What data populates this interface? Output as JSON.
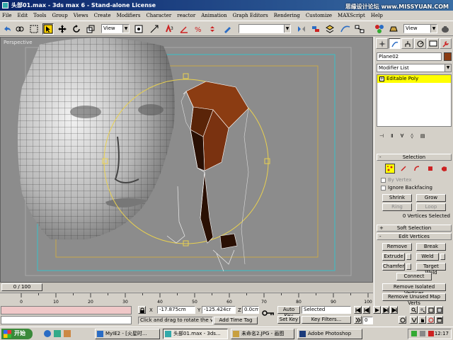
{
  "window": {
    "title": "头部01.max - 3ds max 6 - Stand-alone License",
    "watermark": "思缘设计论坛 www.MISSYUAN.COM"
  },
  "menu": [
    "File",
    "Edit",
    "Tools",
    "Group",
    "Views",
    "Create",
    "Modifiers",
    "Character",
    "reactor",
    "Animation",
    "Graph Editors",
    "Rendering",
    "Customize",
    "MAXScript",
    "Help"
  ],
  "toolbar": {
    "filter_value": "All",
    "refcoord_value": "View",
    "named_sel_value": "",
    "view_right": "View"
  },
  "viewport": {
    "label": "Perspective"
  },
  "command_panel": {
    "object_name": "Plane02",
    "modifier_list": "Modifier List",
    "stack_item": "Editable Poly",
    "selection": {
      "title": "Selection",
      "by_vertex": "By Vertex",
      "ignore_backfacing": "Ignore Backfacing",
      "shrink": "Shrink",
      "grow": "Grow",
      "ring": "Ring",
      "loop": "Loop",
      "status": "0 Vertices Selected"
    },
    "soft_selection": "Soft Selection",
    "edit_vertices": {
      "title": "Edit Vertices",
      "remove": "Remove",
      "break": "Break",
      "extrude": "Extrude",
      "weld": "Weld",
      "chamfer": "Chamfer",
      "target_weld": "Target Weld",
      "connect": "Connect",
      "remove_isolated": "Remove Isolated Vertices",
      "remove_unused": "Remove Unused Map Verts"
    }
  },
  "timeline": {
    "slider_label": "0 / 100",
    "ticks": [
      "0",
      "10",
      "20",
      "30",
      "40",
      "50",
      "60",
      "70",
      "80",
      "90",
      "100"
    ]
  },
  "status": {
    "prompt": "Click and drag to rotate the view.",
    "add_time_tag": "Add Time Tag",
    "x_label": "X",
    "x_value": "-17.875cm",
    "y_label": "Y",
    "y_value": "-125.424cr",
    "z_label": "Z",
    "z_value": "0.0cm",
    "auto_key": "Auto Key",
    "set_key": "Set Key",
    "selected": "Selected",
    "key_filters": "Key Filters...",
    "frame": "0"
  },
  "taskbar": {
    "start": "开始",
    "tasks": [
      "MyIE2 - [火星时...",
      "头部01.max - 3ds...",
      "未命名2.JPG - 画图",
      "Adobe Photoshop"
    ],
    "clock": "12:17"
  },
  "colors": {
    "title_start": "#0a246a",
    "title_end": "#3a6ea5",
    "stack_highlight": "#ffff00",
    "object_color": "#8b3c12",
    "mesh_brown": "#8b3c12"
  }
}
